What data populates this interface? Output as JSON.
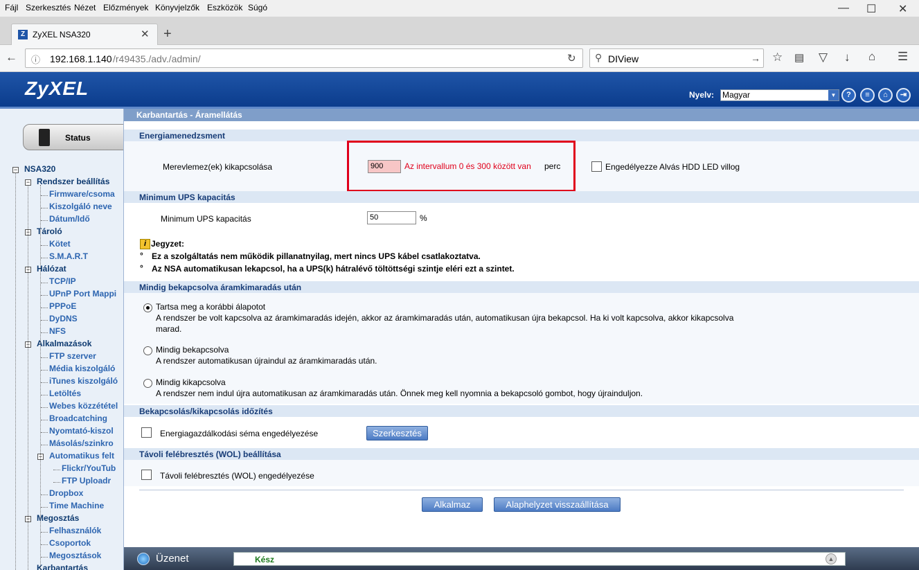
{
  "browser": {
    "menu": [
      "Fájl",
      "Szerkesztés",
      "Nézet",
      "Előzmények",
      "Könyvjelzők",
      "Eszközök",
      "Súgó"
    ],
    "tab_title": "ZyXEL NSA320",
    "url_host": "192.168.1.140",
    "url_path": "/r49435./adv./admin/",
    "search_value": "DIView"
  },
  "header": {
    "logo": "ZyXEL",
    "language_label": "Nyelv:",
    "language_value": "Magyar"
  },
  "sidebar": {
    "status_label": "Status",
    "tree": [
      {
        "label": "NSA320",
        "level": 0
      },
      {
        "label": "Rendszer beállítás",
        "level": 1
      },
      {
        "label": "Firmware/csoma",
        "level": 2
      },
      {
        "label": "Kiszolgáló neve",
        "level": 2
      },
      {
        "label": "Dátum/Idő",
        "level": 2
      },
      {
        "label": "Tároló",
        "level": 1
      },
      {
        "label": "Kötet",
        "level": 2
      },
      {
        "label": "S.M.A.R.T",
        "level": 2
      },
      {
        "label": "Hálózat",
        "level": 1
      },
      {
        "label": "TCP/IP",
        "level": 2
      },
      {
        "label": "UPnP Port Mappi",
        "level": 2
      },
      {
        "label": "PPPoE",
        "level": 2
      },
      {
        "label": "DyDNS",
        "level": 2
      },
      {
        "label": "NFS",
        "level": 2
      },
      {
        "label": "Alkalmazások",
        "level": 1
      },
      {
        "label": "FTP szerver",
        "level": 2
      },
      {
        "label": "Média kiszolgáló",
        "level": 2
      },
      {
        "label": "iTunes kiszolgáló",
        "level": 2
      },
      {
        "label": "Letöltés",
        "level": 2
      },
      {
        "label": "Webes közzététel",
        "level": 2
      },
      {
        "label": "Broadcatching",
        "level": 2
      },
      {
        "label": "Nyomtató-kiszol",
        "level": 2
      },
      {
        "label": "Másolás/szinkro",
        "level": 2
      },
      {
        "label": "Automatikus felt",
        "level": 2
      },
      {
        "label": "Flickr/YouTub",
        "level": 3
      },
      {
        "label": "FTP Uploadr",
        "level": 3
      },
      {
        "label": "Dropbox",
        "level": 2
      },
      {
        "label": "Time Machine",
        "level": 2
      },
      {
        "label": "Megosztás",
        "level": 1
      },
      {
        "label": "Felhasználók",
        "level": 2
      },
      {
        "label": "Csoportok",
        "level": 2
      },
      {
        "label": "Megosztások",
        "level": 2
      },
      {
        "label": "Karbantartás",
        "level": 1
      }
    ]
  },
  "main": {
    "title": "Karbantartás - Áramellátás",
    "energy": {
      "section": "Energiamenedzsment",
      "hdd_label": "Merevlemez(ek) kikapcsolása",
      "hdd_value": "900",
      "hdd_error": "Az intervallum 0 és 300 között van",
      "hdd_unit": "perc",
      "led_label": "Engedélyezze Alvás HDD LED villog"
    },
    "ups": {
      "section": "Minimum UPS kapacitás",
      "label": "Minimum UPS kapacitás",
      "value": "50",
      "unit": "%"
    },
    "note": {
      "title": "Jegyzet:",
      "items": [
        "Ez a szolgáltatás nem működik pillanatnyilag, mert nincs UPS kábel csatlakoztatva.",
        "Az NSA automatikusan lekapcsol, ha a UPS(k) hátralévő töltöttségi szintje eléri ezt a szintet."
      ]
    },
    "power_restore": {
      "section": "Mindig bekapcsolva áramkimaradás után",
      "options": [
        {
          "label": "Tartsa meg a korábbi álapotot",
          "desc1": "A rendszer be volt kapcsolva az áramkimaradás idején, akkor az áramkimaradás után, automatikusan újra bekapcsol. Ha ki volt kapcsolva, akkor kikapcsolva",
          "desc2": "marad."
        },
        {
          "label": "Mindig bekapcsolva",
          "desc1": "A rendszer automatikusan újraindul az áramkimaradás után.",
          "desc2": ""
        },
        {
          "label": "Mindig kikapcsolva",
          "desc1": "A rendszer nem indul újra automatikusan az áramkimaradás után. Önnek meg kell nyomnia a bekapcsoló gombot, hogy újrainduljon.",
          "desc2": ""
        }
      ]
    },
    "schedule": {
      "section": "Bekapcsolás/kikapcsolás időzítés",
      "label": "Energiagazdálkodási séma engedélyezése",
      "edit_button": "Szerkesztés"
    },
    "wol": {
      "section": "Távoli felébresztés (WOL) beállítása",
      "label": "Távoli felébresztés (WOL) engedélyezése"
    },
    "apply_button": "Alkalmaz",
    "reset_button": "Alaphelyzet visszaállítása"
  },
  "bottom": {
    "message_label": "Üzenet",
    "message_value": "Kész"
  }
}
